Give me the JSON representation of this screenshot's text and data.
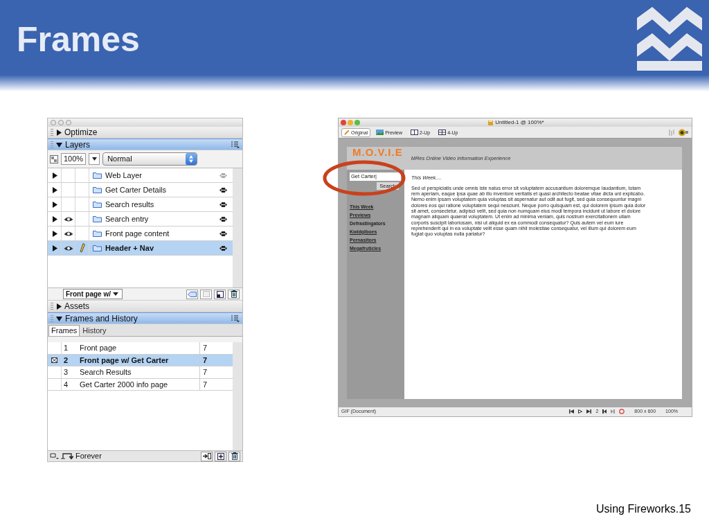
{
  "slide": {
    "title": "Frames",
    "footer": "Using Fireworks.15"
  },
  "panel": {
    "optimize": {
      "title": "Optimize",
      "expanded": false
    },
    "layers": {
      "title": "Layers",
      "expanded": true,
      "opacity": "100%",
      "blend_mode": "Normal",
      "frame_selector": "Front page w/",
      "rows": [
        {
          "name": "Web Layer",
          "visible": false,
          "editable": false,
          "selected": false
        },
        {
          "name": "Get Carter Details",
          "visible": false,
          "editable": false,
          "selected": false
        },
        {
          "name": "Search results",
          "visible": false,
          "editable": false,
          "selected": false
        },
        {
          "name": "Search entry",
          "visible": true,
          "editable": false,
          "selected": false
        },
        {
          "name": "Front page content",
          "visible": true,
          "editable": false,
          "selected": false
        },
        {
          "name": "Header + Nav",
          "visible": true,
          "editable": true,
          "selected": true
        }
      ]
    },
    "assets": {
      "title": "Assets",
      "expanded": false
    },
    "frames_and_history": {
      "title": "Frames and History",
      "expanded": true,
      "tabs": [
        {
          "label": "Frames",
          "selected": true
        },
        {
          "label": "History",
          "selected": false
        }
      ],
      "rows": [
        {
          "number": "1",
          "name": "Front page",
          "delay": "7",
          "selected": false
        },
        {
          "number": "2",
          "name": "Front page w/ Get Carter",
          "delay": "7",
          "selected": true
        },
        {
          "number": "3",
          "name": "Search Results",
          "delay": "7",
          "selected": false
        },
        {
          "number": "4",
          "name": "Get Carter 2000 info page",
          "delay": "7",
          "selected": false
        }
      ],
      "loop": "Forever"
    }
  },
  "document": {
    "title": "Untitled-1 @ 100%*",
    "view_tabs": [
      {
        "label": "Original",
        "selected": true
      },
      {
        "label": "Preview",
        "selected": false
      },
      {
        "label": "2-Up",
        "selected": false
      },
      {
        "label": "4-Up",
        "selected": false
      }
    ],
    "page": {
      "logo": "M.O.V.I.E",
      "tagline": "MRes Online Video Information Experience",
      "search_value": "Get Carter|",
      "search_button": "Search",
      "nav": [
        {
          "label": "This Week",
          "linked": true
        },
        {
          "label": "Previews",
          "linked": true
        },
        {
          "label": "Defrastingators",
          "linked": false
        },
        {
          "label": "Kwidgiboes",
          "linked": true
        },
        {
          "label": "Pernasitors",
          "linked": true
        },
        {
          "label": "Megafruticles",
          "linked": true
        }
      ],
      "heading": "This Week....",
      "body": "Sed ut perspiciatis unde omnis iste natus error sit voluptatem accusantium doloremque laudantium, totam rem aperiam, eaque ipsa quae ab illo inventore veritatis et quasi architecto beatae vitae dicta unt explicabo. Nemo enim ipsam voluptatem quia voluptas sit aspernatur aut odit aut fugit, sed quia consequuntur magni dolores eos qui ratione voluptatem sequi nesciunt. Neque porro quisquam est, qui dolorem ipsum quia dolor sit amet, consectetur, adipisci velit, sed quia non numquam eius modi tempora incidunt ut labore et dolore magnam aliquam quaerat voluptatem. Ut enim ad minima veniam, quis nostrum exercitationem ullam corporis suscipit laboriosam, nisi ut aliquid ex ea commodi consequatur? Quis autem vel eum iure reprehenderit qui in ea voluptate velit esse quam nihil molestiae consequatur, vel illum qui dolorem eum fugiat quo voluptas nulla pariatur?"
    },
    "status": {
      "file_type": "GIF (Document)",
      "frame": "2",
      "size": "800 x 600",
      "zoom": "100%"
    }
  }
}
